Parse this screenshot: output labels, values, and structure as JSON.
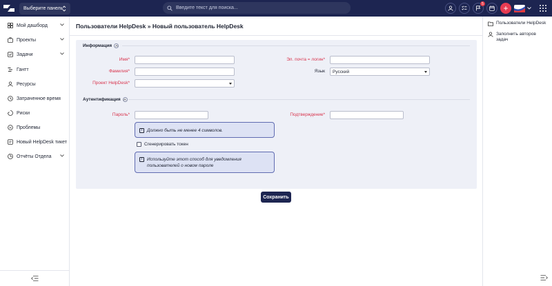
{
  "topbar": {
    "panel_select": "Выберите панель",
    "search_placeholder": "Введите текст для поиска...",
    "notification_count": "5"
  },
  "sidebar": {
    "items": [
      {
        "label": "Мой дашборд",
        "icon": "dashboard-icon",
        "has_chevron": true
      },
      {
        "label": "Проекты",
        "icon": "briefcase-icon",
        "has_chevron": true
      },
      {
        "label": "Задачи",
        "icon": "tasks-icon",
        "has_chevron": true
      },
      {
        "label": "Гантт",
        "icon": "gantt-icon",
        "has_chevron": false
      },
      {
        "label": "Ресурсы",
        "icon": "user-icon",
        "has_chevron": false
      },
      {
        "label": "Затраченное время",
        "icon": "clock-icon",
        "has_chevron": false
      },
      {
        "label": "Риски",
        "icon": "risk-icon",
        "has_chevron": false
      },
      {
        "label": "Проблемы",
        "icon": "problem-icon",
        "has_chevron": false
      },
      {
        "label": "Новый HelpDesk тикет",
        "icon": "ticket-icon",
        "has_chevron": false
      },
      {
        "label": "Отчёты Отдела",
        "icon": "reports-icon",
        "has_chevron": true
      }
    ]
  },
  "main": {
    "title": "Пользователи HelpDesk » Новый пользователь HelpDesk",
    "section_info": "Информация",
    "section_auth": "Аутентификация",
    "fields": {
      "first_name_label": "Имя*",
      "first_name_value": "",
      "last_name_label": "Фамилия*",
      "last_name_value": "",
      "project_label": "Проект HelpDesk*",
      "project_value": "",
      "email_label": "Эл. почта = логин*",
      "email_value": "",
      "language_label": "Язык",
      "language_value": "Русский",
      "password_label": "Пароль*",
      "confirm_label": "Подтверждение*"
    },
    "password_hint": "Должно быть не менее 4 символов.",
    "generate_token_label": "Сгенерировать токен",
    "token_hint": "Используйте этот способ для уведомления пользователей о новом пароле",
    "save_button": "Сохранить"
  },
  "right_panel": {
    "links": [
      {
        "label": "Пользователи HelpDesk",
        "icon": "folder-icon"
      },
      {
        "label": "Заполнить авторов задач",
        "icon": "user-icon"
      }
    ]
  },
  "colors": {
    "topbar": "#1d2551",
    "accent_red": "#e63b52",
    "required_label": "#d8334c",
    "hint_bg": "#dde2f4",
    "hint_border": "#5f6bb1"
  }
}
